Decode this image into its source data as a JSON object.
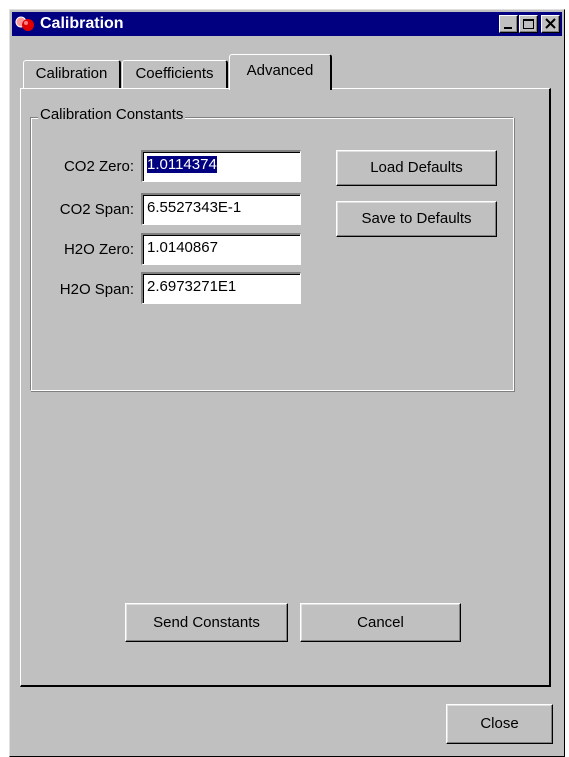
{
  "window": {
    "title": "Calibration"
  },
  "tabs": [
    {
      "label": "Calibration"
    },
    {
      "label": "Coefficients"
    },
    {
      "label": "Advanced",
      "selected": true
    }
  ],
  "group": {
    "legend": "Calibration Constants"
  },
  "fields": [
    {
      "label": "CO2 Zero:",
      "value": "1.0114374"
    },
    {
      "label": "CO2 Span:",
      "value": "6.5527343E-1"
    },
    {
      "label": "H2O Zero:",
      "value": "1.0140867"
    },
    {
      "label": "H2O Span:",
      "value": "2.6973271E1"
    }
  ],
  "buttons": {
    "load_defaults": "Load Defaults",
    "save_defaults": "Save to Defaults",
    "send_constants": "Send Constants",
    "cancel": "Cancel",
    "close": "Close"
  },
  "colors": {
    "titlebar": "#000080",
    "face": "#c0c0c0",
    "selection": "#000080"
  },
  "icons": {
    "app": "calibration-app-icon",
    "minimize": "minimize-icon",
    "maximize": "maximize-icon",
    "close": "close-icon"
  }
}
